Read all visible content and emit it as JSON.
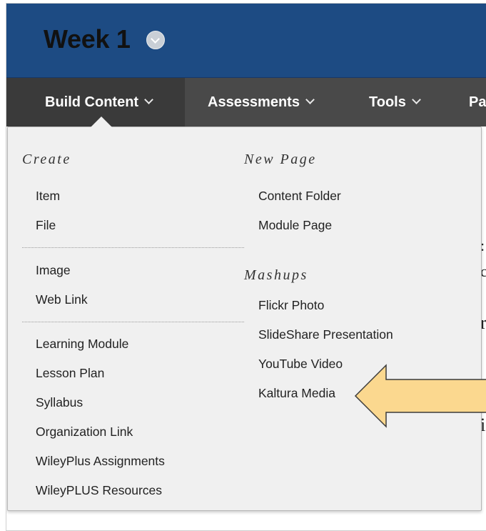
{
  "page": {
    "title": "Week 1"
  },
  "menubar": {
    "build_content": "Build Content",
    "assessments": "Assessments",
    "tools": "Tools",
    "partners": "Pa"
  },
  "dropdown": {
    "create": {
      "heading": "Create",
      "groups": [
        [
          "Item",
          "File"
        ],
        [
          "Image",
          "Web Link"
        ],
        [
          "Learning Module",
          "Lesson Plan",
          "Syllabus",
          "Organization Link",
          "WileyPlus Assignments",
          "WileyPLUS Resources"
        ]
      ]
    },
    "new_page": {
      "heading": "New Page",
      "items": [
        "Content Folder",
        "Module Page"
      ]
    },
    "mashups": {
      "heading": "Mashups",
      "items": [
        "Flickr Photo",
        "SlideShare Presentation",
        "YouTube Video",
        "Kaltura Media"
      ]
    }
  },
  "colors": {
    "header": "#1d4b83",
    "menubar": "#494949",
    "dropdown": "#f0f0f0",
    "arrow": "#fbd88f"
  },
  "icons": {
    "title_menu": "chevron-down-circle-icon",
    "menu_chevron": "chevron-down-icon",
    "callout": "left-arrow-callout"
  }
}
